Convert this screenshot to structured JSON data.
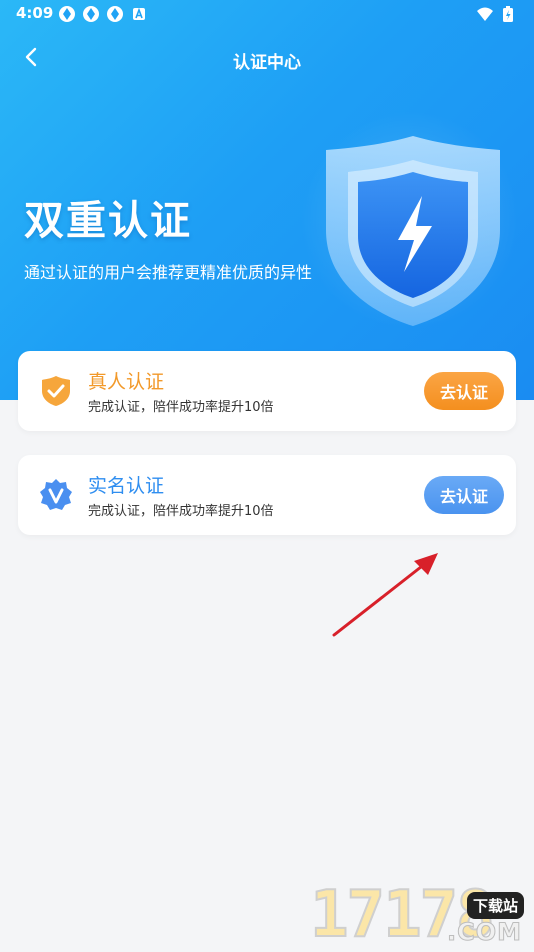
{
  "status_bar": {
    "time": "4:09",
    "notification_icons": [
      "app-icon",
      "app-icon",
      "app-icon",
      "accessibility-icon"
    ],
    "right_icons": [
      "wifi-icon",
      "battery-charging-icon"
    ]
  },
  "header": {
    "title": "认证中心",
    "back_icon": "chevron-left-icon"
  },
  "hero": {
    "title": "双重认证",
    "subtitle": "通过认证的用户会推荐更精准优质的异性",
    "illustration": "shield-lightning-icon"
  },
  "cards": [
    {
      "title": "真人认证",
      "subtitle": "完成认证，陪伴成功率提升10倍",
      "button_label": "去认证",
      "icon": "shield-check-icon",
      "accent_color": "#f2992a"
    },
    {
      "title": "实名认证",
      "subtitle": "完成认证，陪伴成功率提升10倍",
      "button_label": "去认证",
      "icon": "badge-v-icon",
      "accent_color": "#4a93ef"
    }
  ],
  "watermark": {
    "digits": "17178",
    "tag": "下载站",
    "domain": ".COM"
  },
  "colors": {
    "hero_gradient_start": "#2bb8f7",
    "hero_gradient_end": "#1a8cf2",
    "page_background": "#f4f5f7",
    "annotation_arrow": "#d8202a"
  }
}
